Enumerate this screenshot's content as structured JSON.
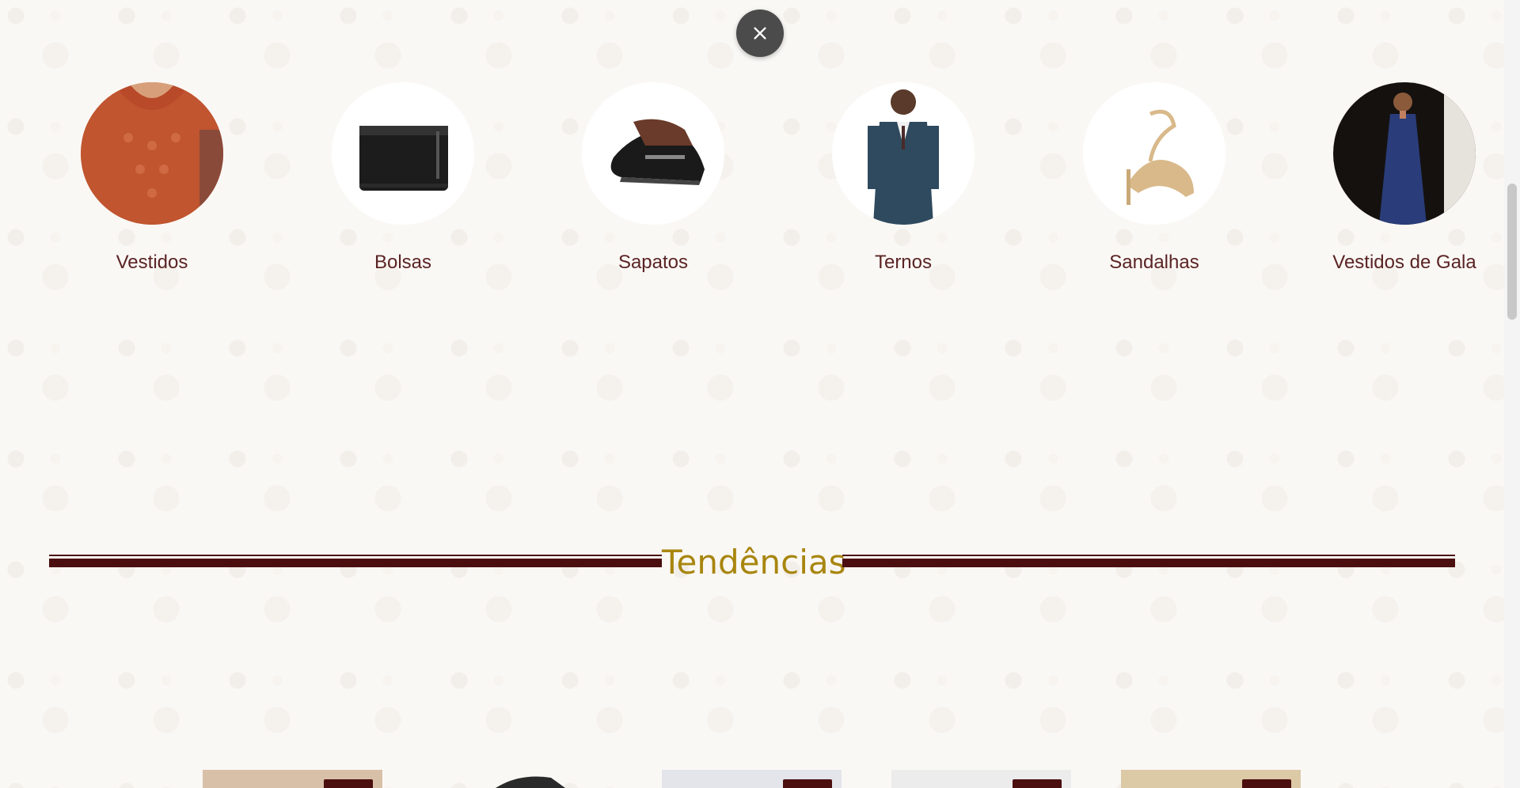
{
  "close_button": {
    "icon": "close-icon",
    "color": "#4b4b4b"
  },
  "categories": [
    {
      "label": "Vestidos",
      "icon": "dress-icon"
    },
    {
      "label": "Bolsas",
      "icon": "bag-icon"
    },
    {
      "label": "Sapatos",
      "icon": "shoe-icon"
    },
    {
      "label": "Ternos",
      "icon": "suit-icon"
    },
    {
      "label": "Sandalhas",
      "icon": "sandal-icon"
    },
    {
      "label": "Vestidos de Gala",
      "icon": "gown-icon"
    }
  ],
  "section": {
    "title": "Tendências"
  },
  "colors": {
    "brand_dark": "#4b0f0f",
    "title_gold": "#a8860f",
    "label": "#5a2424"
  }
}
